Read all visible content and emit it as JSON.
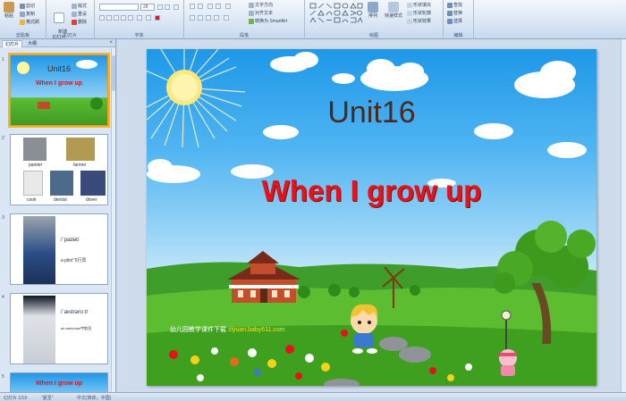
{
  "ribbon": {
    "clipboard": {
      "label": "剪贴板",
      "paste": "粘贴",
      "cut": "剪切",
      "copy": "复制",
      "format_painter": "格式刷"
    },
    "slides": {
      "label": "幻灯片",
      "new_slide": "新建\n幻灯片",
      "layout": "版式",
      "reset": "重设",
      "delete": "删除"
    },
    "font": {
      "label": "字体",
      "font_size": "28"
    },
    "paragraph": {
      "label": "段落",
      "text_direction": "文字方向",
      "align_text": "对齐文本",
      "smartart": "转换为 SmartArt"
    },
    "drawing": {
      "label": "绘图",
      "arrange": "排列",
      "quick_styles": "快速样式",
      "shape_fill": "形状填充",
      "shape_outline": "形状轮廓",
      "shape_effects": "形状效果"
    },
    "editing": {
      "label": "编辑",
      "find": "查找",
      "replace": "替换",
      "select": "选择"
    }
  },
  "left_pane": {
    "tabs": [
      "幻灯片",
      "大纲"
    ],
    "slides": [
      {
        "num": "1",
        "title": "Unit16",
        "subtitle": "When I grow up"
      },
      {
        "num": "2",
        "labels": [
          "painter",
          "farmer",
          "cook",
          "dentist",
          "driver"
        ]
      },
      {
        "num": "3",
        "lines": [
          "/ˈpaɪlət/",
          "a pilot飞行员"
        ]
      },
      {
        "num": "4",
        "lines": [
          "/ˈæstrənɔːt/",
          "an astronaut宇航员"
        ]
      },
      {
        "num": "5",
        "title": "When I grow up"
      }
    ]
  },
  "slide": {
    "title": "Unit16",
    "subtitle": "When I grow up",
    "footer_prefix": "幼儿园教学课件下载",
    "footer_url": "ziyuan.baby611.com"
  },
  "status_bar": {
    "slide_info": "幻灯片 1/19",
    "theme": "\"夏至\"",
    "language": "中文(简体，中国)"
  },
  "colors": {
    "title": "#4a2a1f",
    "subtitle": "#e3141c",
    "sky_top": "#1e98e8",
    "grass": "#4fb02c",
    "selection": "#f2b233"
  }
}
